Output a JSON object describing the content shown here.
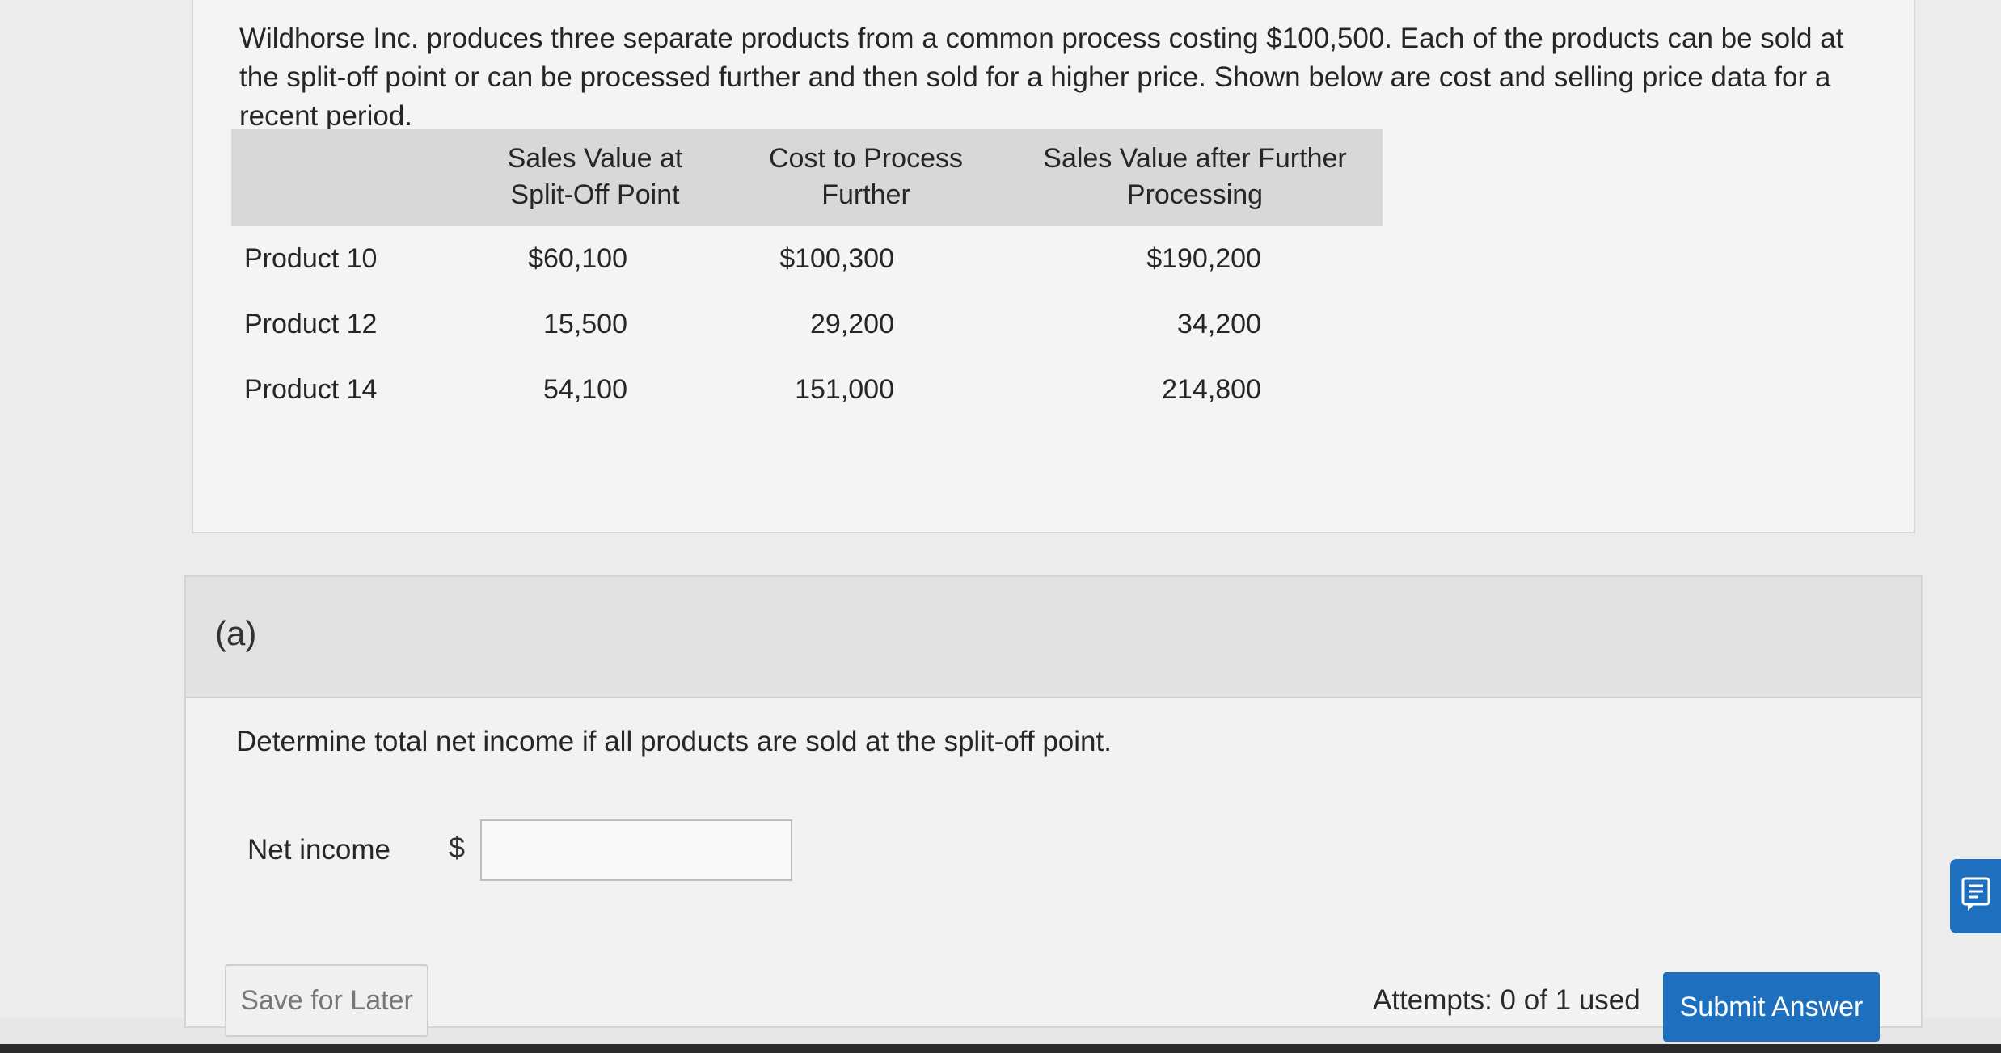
{
  "problem": {
    "intro_text": "Wildhorse Inc. produces three separate products from a common process costing $100,500. Each of the products can be sold at the split-off point or can be processed further and then sold for a higher price. Shown below are cost and selling price data for a recent period."
  },
  "table": {
    "headers": [
      "",
      "Sales Value at Split-Off Point",
      "Cost to Process Further",
      "Sales Value after Further Processing"
    ],
    "rows": [
      [
        "Product 10",
        "$60,100",
        "$100,300",
        "$190,200"
      ],
      [
        "Product 12",
        "15,500",
        "29,200",
        "34,200"
      ],
      [
        "Product 14",
        "54,100",
        "151,000",
        "214,800"
      ]
    ]
  },
  "part": {
    "letter": "(a)",
    "question": "Determine total net income if all products are sold at the split-off point.",
    "net_income_label": "Net income",
    "currency_symbol": "$",
    "net_income_value": ""
  },
  "actions": {
    "save_label": "Save for Later",
    "attempts_text": "Attempts: 0 of 1 used",
    "submit_label": "Submit Answer"
  },
  "icons": {
    "feedback": "feedback-lines-icon"
  },
  "colors": {
    "accent": "#1f6fbf",
    "table_header_bg": "#d8d8d8"
  }
}
